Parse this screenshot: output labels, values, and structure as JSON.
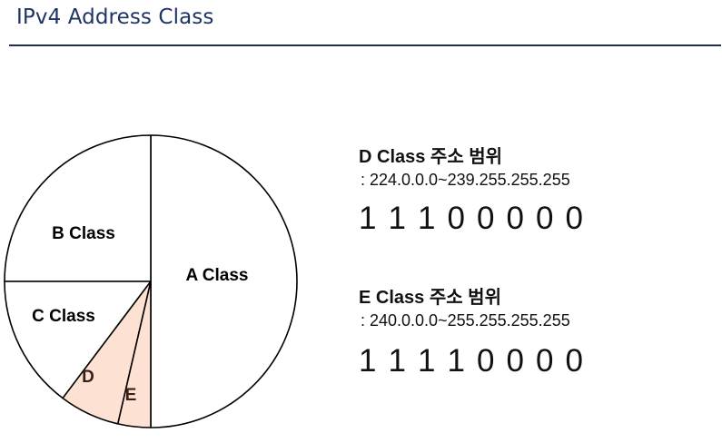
{
  "page": {
    "title": "IPv4 Address Class"
  },
  "pie": {
    "slices": [
      {
        "label": "A Class",
        "fill": "#ffffff"
      },
      {
        "label": "B Class",
        "fill": "#ffffff"
      },
      {
        "label": "C Class",
        "fill": "#ffffff"
      },
      {
        "label": "D",
        "fill": "#fde1d3"
      },
      {
        "label": "E",
        "fill": "#fde1d3"
      }
    ],
    "stroke": "#000000"
  },
  "info": {
    "d_class": {
      "heading": "D Class 주소 범위",
      "range": ": 224.0.0.0~239.255.255.255",
      "bits": [
        "1",
        "1",
        "1",
        "0",
        "0",
        "0",
        "0",
        "0"
      ]
    },
    "e_class": {
      "heading": "E Class 주소 범위",
      "range": ": 240.0.0.0~255.255.255.255",
      "bits": [
        "1",
        "1",
        "1",
        "1",
        "0",
        "0",
        "0",
        "0"
      ]
    }
  }
}
